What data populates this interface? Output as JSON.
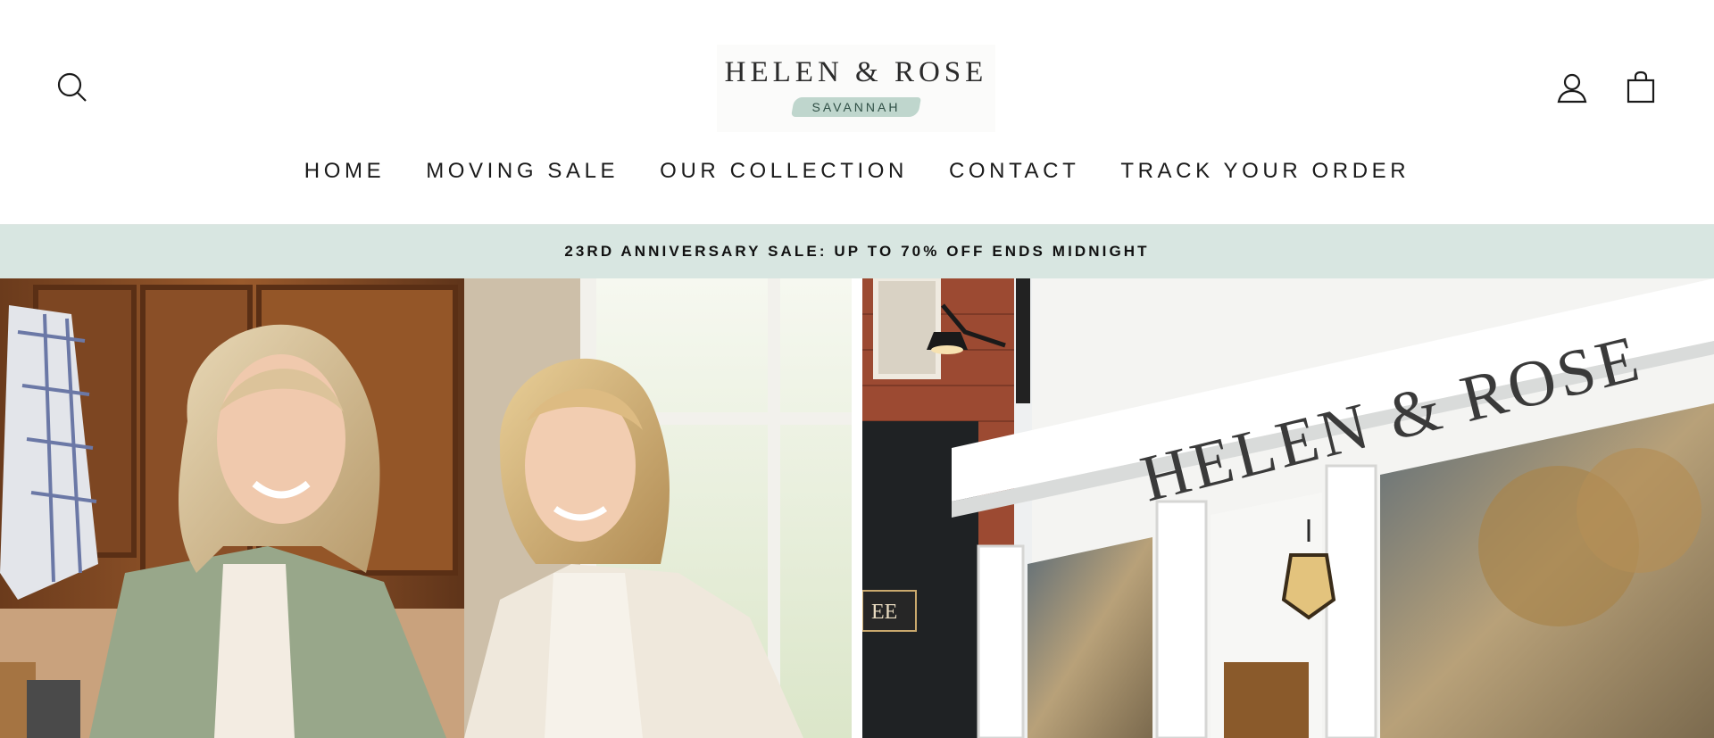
{
  "header": {
    "logo": {
      "title": "HELEN & ROSE",
      "subtitle": "SAVANNAH"
    },
    "icons": {
      "search": "search-icon",
      "account": "user-icon",
      "cart": "shopping-bag-icon"
    }
  },
  "nav": {
    "items": [
      {
        "label": "HOME"
      },
      {
        "label": "MOVING SALE"
      },
      {
        "label": "OUR COLLECTION"
      },
      {
        "label": "CONTACT"
      },
      {
        "label": "TRACK YOUR ORDER"
      }
    ]
  },
  "announcement": {
    "text": "23RD ANNIVERSARY SALE: UP TO 70% OFF ENDS MIDNIGHT"
  },
  "hero": {
    "storefront_sign": "HELEN & ROSE",
    "side_sign": "EE"
  },
  "colors": {
    "announcement_bg": "#d8e6e1",
    "logo_accent": "#bfd6cd",
    "text": "#1a1a1a"
  }
}
